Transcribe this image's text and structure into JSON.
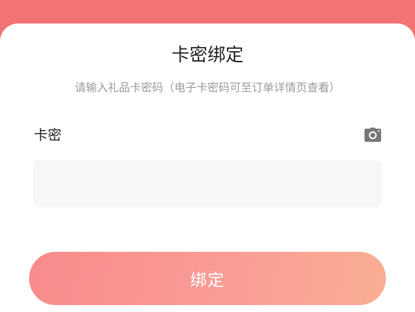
{
  "dialog": {
    "title": "卡密绑定",
    "subtitle": "请输入礼品卡密码（电子卡密码可至订单详情页查看）"
  },
  "form": {
    "field_label": "卡密",
    "input_value": "",
    "scan_icon": "camera-icon"
  },
  "actions": {
    "bind_label": "绑定"
  },
  "colors": {
    "header_band": "#f27374",
    "button_gradient_start": "#f98a8b",
    "button_gradient_end": "#f9ae93",
    "input_background": "#f7f7f7",
    "subtitle_text": "#9a9a9a"
  }
}
